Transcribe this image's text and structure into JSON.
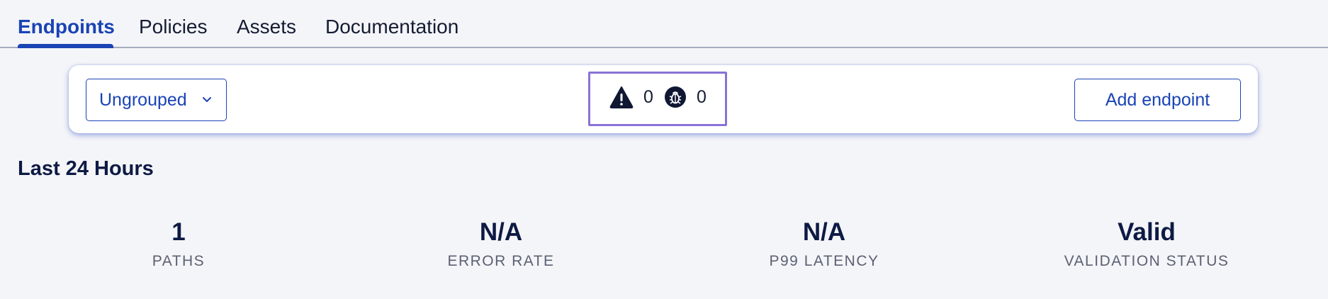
{
  "tabs": [
    {
      "label": "Endpoints",
      "active": true
    },
    {
      "label": "Policies",
      "active": false
    },
    {
      "label": "Assets",
      "active": false
    },
    {
      "label": "Documentation",
      "active": false
    }
  ],
  "toolbar": {
    "group_select": {
      "value": "Ungrouped",
      "icon": "chevron-down-icon"
    },
    "counters": {
      "warnings": {
        "icon": "warning-icon",
        "count": "0"
      },
      "bugs": {
        "icon": "bug-icon",
        "count": "0"
      }
    },
    "add_button_label": "Add endpoint"
  },
  "section": {
    "title": "Last 24 Hours"
  },
  "stats": [
    {
      "value": "1",
      "label": "PATHS"
    },
    {
      "value": "N/A",
      "label": "ERROR RATE"
    },
    {
      "value": "N/A",
      "label": "P99 LATENCY"
    },
    {
      "value": "Valid",
      "label": "VALIDATION STATUS"
    }
  ],
  "colors": {
    "accent": "#1a43b5",
    "background": "#f4f5f8",
    "highlight_border": "#8a72d6",
    "text_dark": "#0d1a44",
    "text_muted": "#5b6173"
  }
}
